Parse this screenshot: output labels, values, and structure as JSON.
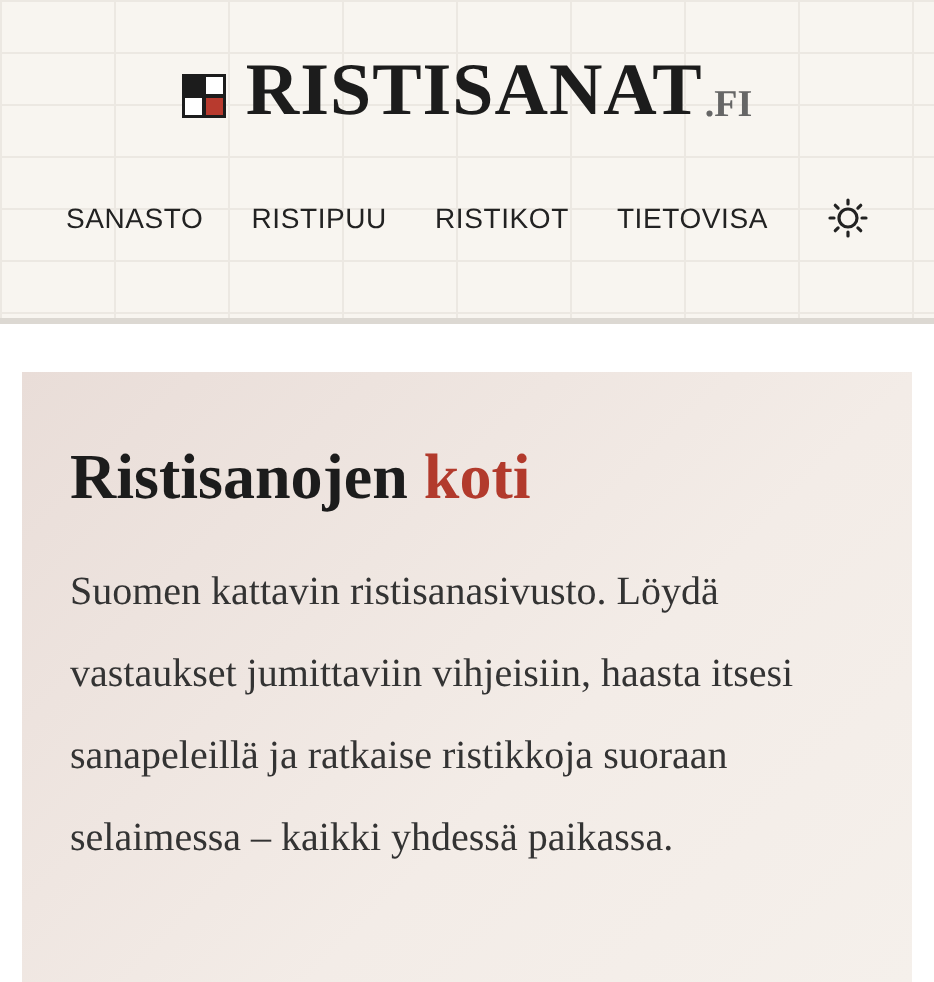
{
  "logo": {
    "name": "RISTISANAT",
    "suffix": ".FI"
  },
  "nav": [
    {
      "label": "SANASTO"
    },
    {
      "label": "RISTIPUU"
    },
    {
      "label": "RISTIKOT"
    },
    {
      "label": "TIETOVISA"
    }
  ],
  "hero": {
    "title": "Ristisanojen",
    "title_accent": "koti",
    "text": "Suomen kattavin ristisanasivusto. Löydä vastaukset jumittaviin vihjeisiin, haasta itsesi sanapeleillä ja ratkaise ristikkoja suoraan selaimessa – kaikki yhdessä paikassa."
  }
}
